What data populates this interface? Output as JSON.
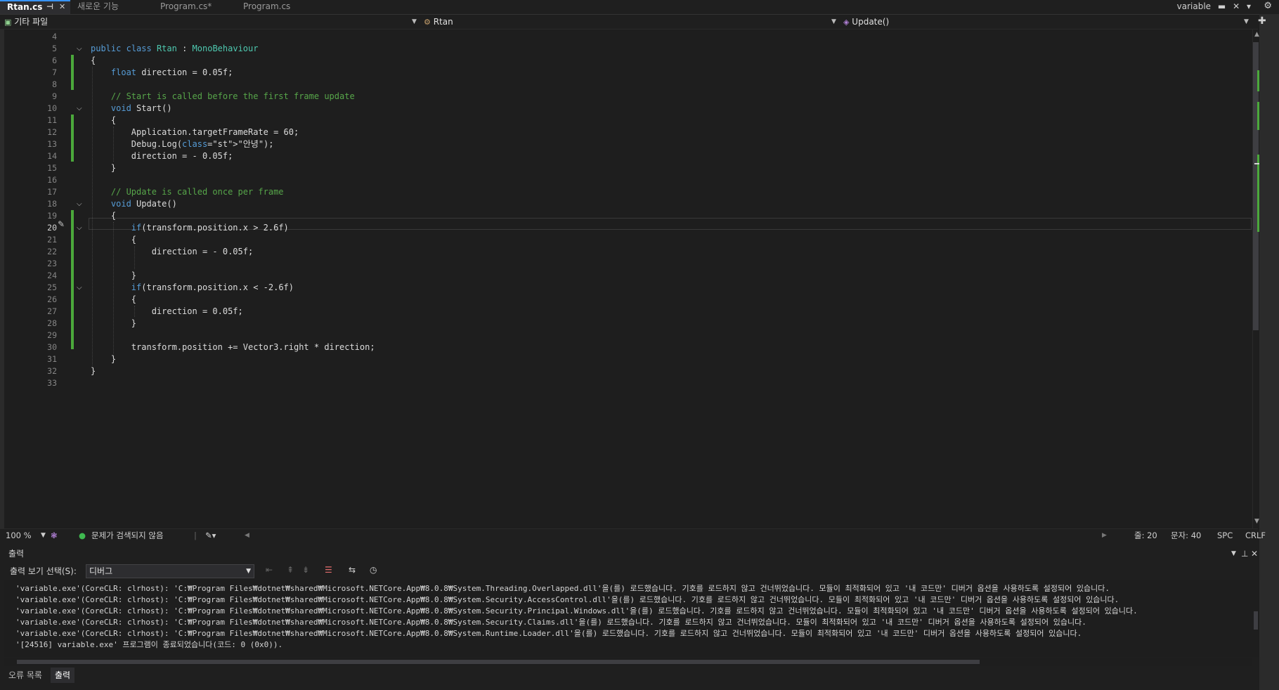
{
  "tabs": [
    {
      "label": "Rtan.cs",
      "active": true
    },
    {
      "label": "새로운 기능",
      "active": false
    },
    {
      "label": "Program.cs*",
      "active": false
    },
    {
      "label": "Program.cs",
      "active": false
    }
  ],
  "project_label": "variable",
  "nav": {
    "project": "기타 파일",
    "class": "Rtan",
    "member": "Update()"
  },
  "code_lines": [
    {
      "n": "4",
      "t": ""
    },
    {
      "n": "5",
      "t": "public class Rtan : MonoBehaviour"
    },
    {
      "n": "6",
      "t": "{"
    },
    {
      "n": "7",
      "t": "    float direction = 0.05f;"
    },
    {
      "n": "8",
      "t": ""
    },
    {
      "n": "9",
      "t": "    // Start is called before the first frame update"
    },
    {
      "n": "10",
      "t": "    void Start()"
    },
    {
      "n": "11",
      "t": "    {"
    },
    {
      "n": "12",
      "t": "        Application.targetFrameRate = 60;"
    },
    {
      "n": "13",
      "t": "        Debug.Log(\"안녕\");"
    },
    {
      "n": "14",
      "t": "        direction = - 0.05f;"
    },
    {
      "n": "15",
      "t": "    }"
    },
    {
      "n": "16",
      "t": ""
    },
    {
      "n": "17",
      "t": "    // Update is called once per frame"
    },
    {
      "n": "18",
      "t": "    void Update()"
    },
    {
      "n": "19",
      "t": "    {"
    },
    {
      "n": "20",
      "t": "        if(transform.position.x > 2.6f)"
    },
    {
      "n": "21",
      "t": "        {"
    },
    {
      "n": "22",
      "t": "            direction = - 0.05f;"
    },
    {
      "n": "23",
      "t": ""
    },
    {
      "n": "24",
      "t": "        }"
    },
    {
      "n": "25",
      "t": "        if(transform.position.x < -2.6f)"
    },
    {
      "n": "26",
      "t": "        {"
    },
    {
      "n": "27",
      "t": "            direction = 0.05f;"
    },
    {
      "n": "28",
      "t": "        }"
    },
    {
      "n": "29",
      "t": ""
    },
    {
      "n": "30",
      "t": "        transform.position += Vector3.right * direction;"
    },
    {
      "n": "31",
      "t": "    }"
    },
    {
      "n": "32",
      "t": "}"
    },
    {
      "n": "33",
      "t": ""
    }
  ],
  "editor_status": {
    "zoom": "100 %",
    "issues": "문제가 검색되지 않음",
    "line": "줄: 20",
    "col": "문자: 40",
    "whitespace": "SPC",
    "eol": "CRLF"
  },
  "output": {
    "title": "출력",
    "source_label": "출력 보기 선택(S):",
    "source_value": "디버그",
    "lines": [
      "'variable.exe'(CoreCLR: clrhost): 'C:₩Program Files₩dotnet₩shared₩Microsoft.NETCore.App₩8.0.8₩System.Threading.Overlapped.dll'을(를) 로드했습니다. 기호를 로드하지 않고 건너뛰었습니다. 모듈이 최적화되어 있고 '내 코드만' 디버거 옵션을 사용하도록 설정되어 있습니다.",
      "'variable.exe'(CoreCLR: clrhost): 'C:₩Program Files₩dotnet₩shared₩Microsoft.NETCore.App₩8.0.8₩System.Security.AccessControl.dll'을(를) 로드했습니다. 기호를 로드하지 않고 건너뛰었습니다. 모듈이 최적화되어 있고 '내 코드만' 디버거 옵션을 사용하도록 설정되어 있습니다.",
      "'variable.exe'(CoreCLR: clrhost): 'C:₩Program Files₩dotnet₩shared₩Microsoft.NETCore.App₩8.0.8₩System.Security.Principal.Windows.dll'을(를) 로드했습니다. 기호를 로드하지 않고 건너뛰었습니다. 모듈이 최적화되어 있고 '내 코드만' 디버거 옵션을 사용하도록 설정되어 있습니다.",
      "'variable.exe'(CoreCLR: clrhost): 'C:₩Program Files₩dotnet₩shared₩Microsoft.NETCore.App₩8.0.8₩System.Security.Claims.dll'을(를) 로드했습니다. 기호를 로드하지 않고 건너뛰었습니다. 모듈이 최적화되어 있고 '내 코드만' 디버거 옵션을 사용하도록 설정되어 있습니다.",
      "'variable.exe'(CoreCLR: clrhost): 'C:₩Program Files₩dotnet₩shared₩Microsoft.NETCore.App₩8.0.8₩System.Runtime.Loader.dll'을(를) 로드했습니다. 기호를 로드하지 않고 건너뛰었습니다. 모듈이 최적화되어 있고 '내 코드만' 디버거 옵션을 사용하도록 설정되어 있습니다.",
      "'[24516] variable.exe' 프로그램이 종료되었습니다(코드: 0 (0x0))."
    ]
  },
  "bottom_tabs": [
    {
      "label": "오류 목록",
      "active": false
    },
    {
      "label": "출력",
      "active": true
    }
  ]
}
